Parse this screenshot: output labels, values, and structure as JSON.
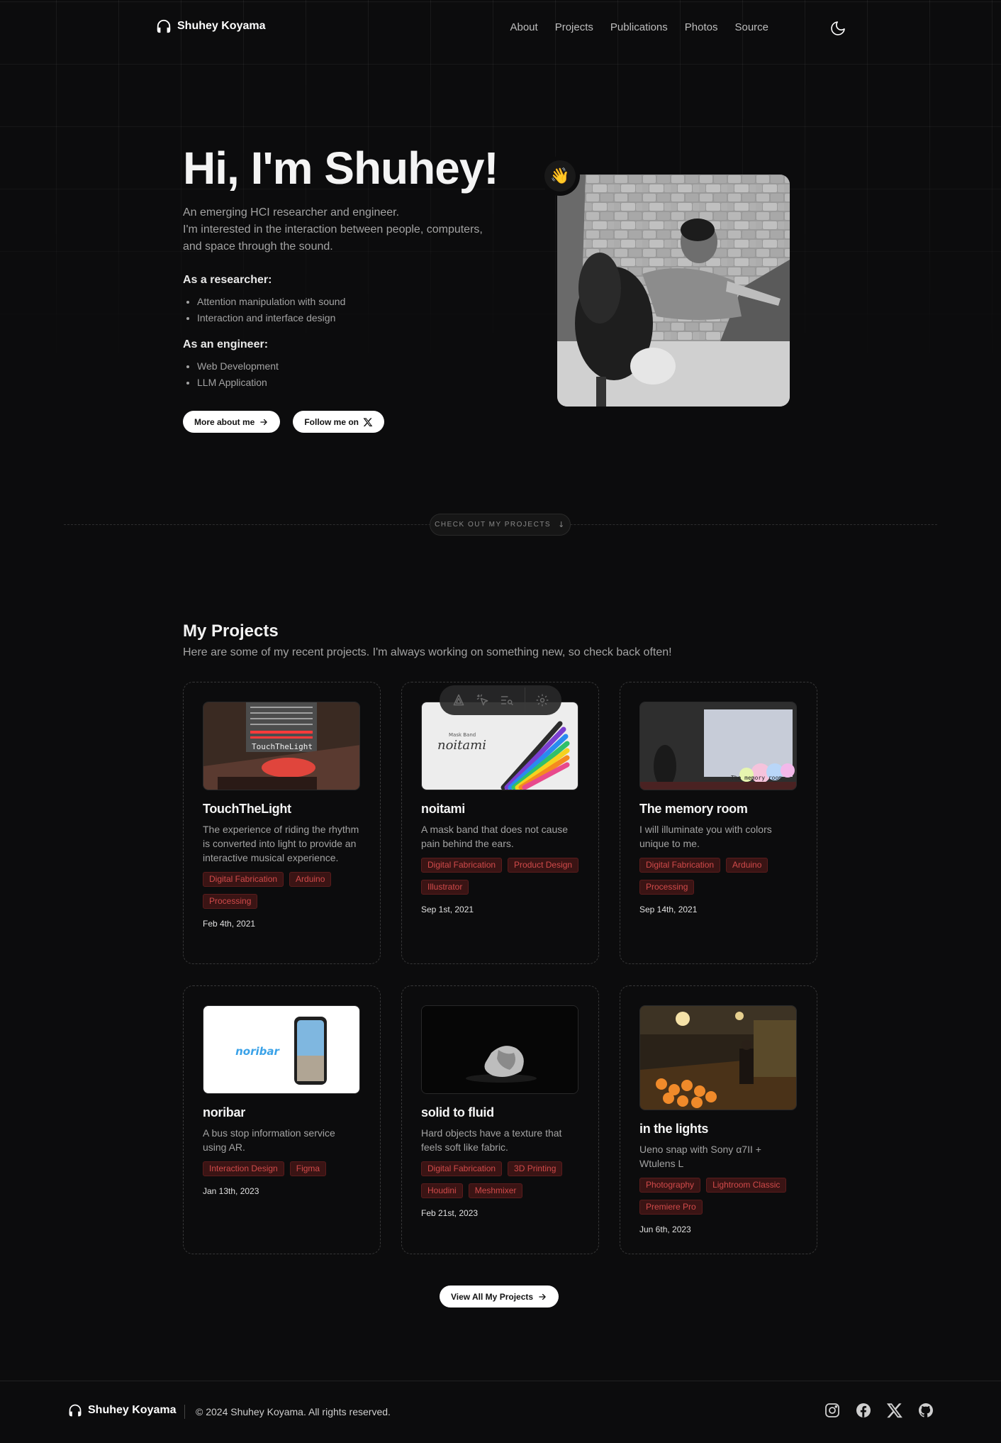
{
  "header": {
    "brand": "Shuhey Koyama",
    "nav": [
      "About",
      "Projects",
      "Publications",
      "Photos",
      "Source"
    ]
  },
  "hero": {
    "title": "Hi, I'm Shuhey!",
    "intro_lines": [
      "An emerging HCI researcher and engineer.",
      "I'm interested in the interaction between people, computers,",
      "and space through the sound."
    ],
    "researcher_heading": "As a researcher:",
    "researcher_items": [
      "Attention manipulation with sound",
      "Interaction and interface design"
    ],
    "engineer_heading": "As an engineer:",
    "engineer_items": [
      "Web Development",
      "LLM Application"
    ],
    "more_button": "More about me",
    "follow_button": "Follow me on",
    "wave_emoji": "👋"
  },
  "divider": {
    "label": "CHECK OUT MY PROJECTS"
  },
  "projects": {
    "title": "My Projects",
    "subtitle": "Here are some of my recent projects. I'm always working on something new, so check back often!",
    "items": [
      {
        "name": "TouchTheLight",
        "desc": "The experience of riding the rhythm is converted into light to provide an interactive musical experience.",
        "tags": [
          "Digital Fabrication",
          "Arduino",
          "Processing"
        ],
        "date": "Feb 4th, 2021",
        "img_text": "TouchTheLight"
      },
      {
        "name": "noitami",
        "desc": "A mask band that does not cause pain behind the ears.",
        "tags": [
          "Digital Fabrication",
          "Product Design",
          "Illustrator"
        ],
        "date": "Sep 1st, 2021",
        "img_text": "noitami",
        "img_small": "Mask Band"
      },
      {
        "name": "The memory room",
        "desc": "I will illuminate you with colors unique to me.",
        "tags": [
          "Digital Fabrication",
          "Arduino",
          "Processing"
        ],
        "date": "Sep 14th, 2021",
        "img_text": "The memory room"
      },
      {
        "name": "noribar",
        "desc": "A bus stop information service using AR.",
        "tags": [
          "Interaction Design",
          "Figma"
        ],
        "date": "Jan 13th, 2023",
        "img_text": "noribar"
      },
      {
        "name": "solid to fluid",
        "desc": "Hard objects have a texture that feels soft like fabric.",
        "tags": [
          "Digital Fabrication",
          "3D Printing",
          "Houdini",
          "Meshmixer"
        ],
        "date": "Feb 21st, 2023"
      },
      {
        "name": "in the lights",
        "desc": "Ueno snap with Sony α7II + Wtulens L",
        "tags": [
          "Photography",
          "Lightroom Classic",
          "Premiere Pro"
        ],
        "date": "Jun 6th, 2023"
      }
    ],
    "view_all": "View All My Projects"
  },
  "footer": {
    "brand": "Shuhey Koyama",
    "copyright": "© 2024 Shuhey Koyama. All rights reserved.",
    "socials": [
      "instagram-icon",
      "facebook-icon",
      "x-icon",
      "github-icon"
    ]
  },
  "colors": {
    "background": "#0c0c0d",
    "tag_text": "#d14a4a",
    "tag_bg": "#3a1414"
  }
}
